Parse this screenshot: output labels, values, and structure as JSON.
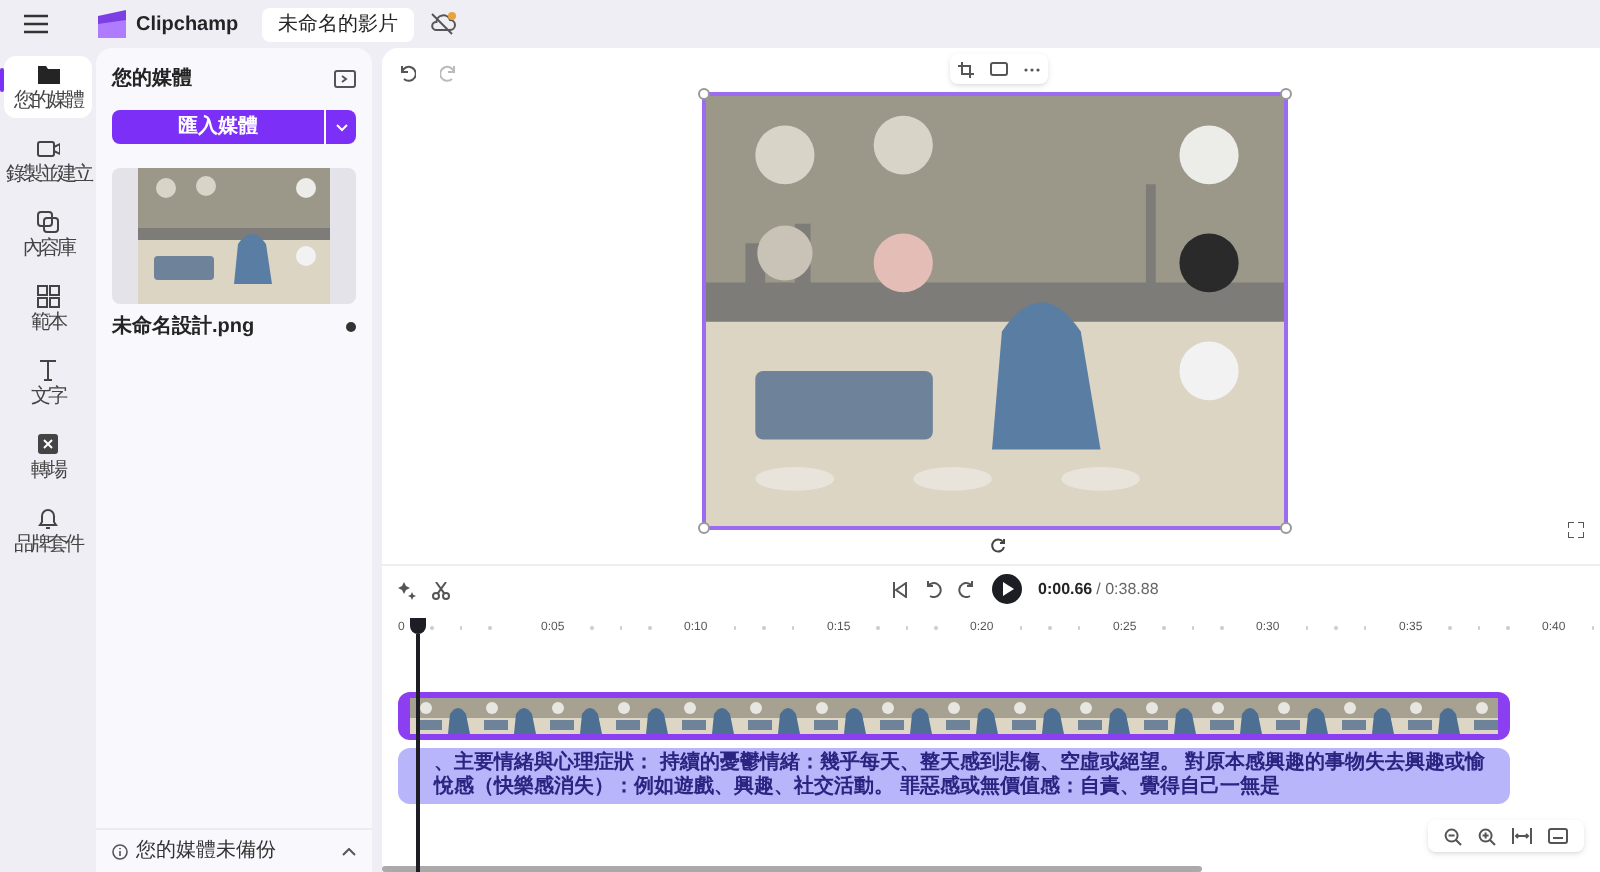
{
  "app": {
    "name": "Clipchamp"
  },
  "project_tab": {
    "title": "未命名的影片"
  },
  "rail": [
    {
      "label": "您的媒體",
      "selected": true,
      "kind": "folder"
    },
    {
      "label": "錄製並建立",
      "selected": false,
      "kind": "camera"
    },
    {
      "label": "內容庫",
      "selected": false,
      "kind": "library"
    },
    {
      "label": "範本",
      "selected": false,
      "kind": "templates"
    },
    {
      "label": "文字",
      "selected": false,
      "kind": "text"
    },
    {
      "label": "轉場",
      "selected": false,
      "kind": "transition"
    },
    {
      "label": "品牌套件",
      "selected": false,
      "kind": "brand"
    }
  ],
  "media_panel": {
    "title": "您的媒體",
    "import_button": "匯入媒體",
    "items": [
      {
        "file_name": "未命名設計.png",
        "kind": "picture"
      }
    ],
    "backup_notice": "您的媒體未備份"
  },
  "player": {
    "current_time": "0:00.66",
    "total_time": "/ 0:38.88"
  },
  "timeline": {
    "ruler": [
      "0",
      "0:05",
      "0:10",
      "0:15",
      "0:20",
      "0:25",
      "0:30",
      "0:35",
      "0:40"
    ],
    "caption_clip": "、主要情緒與心理症狀： 持續的憂鬱情緒：幾乎每天、整天感到悲傷、空虛或絕望。 對原本感興趣的事物失去興趣或愉悅感（快樂感消失）：例如遊戲、興趣、社交活動。 罪惡感或無價值感：自責、覺得自己一無是"
  }
}
